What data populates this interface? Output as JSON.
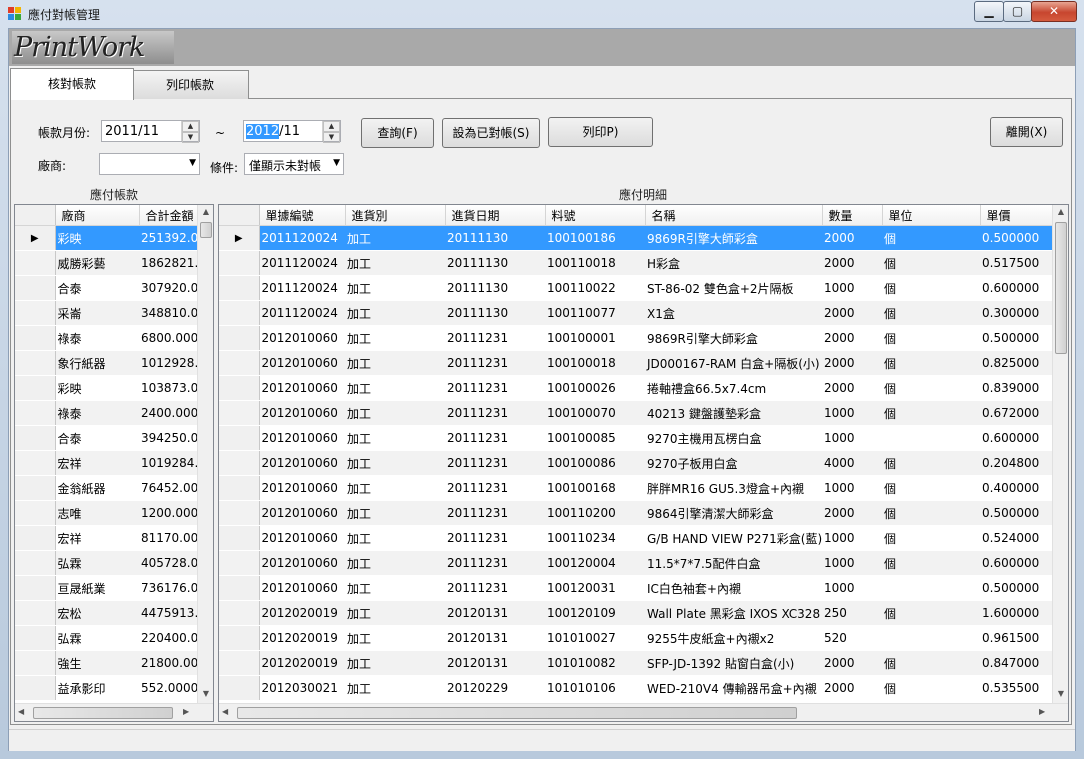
{
  "window": {
    "title": "應付對帳管理"
  },
  "logo": "PrintWork",
  "tabs": [
    {
      "label": "核對帳款"
    },
    {
      "label": "列印帳款"
    }
  ],
  "filters": {
    "period_label": "帳款月份:",
    "from_value": "2011/11",
    "tilde": "~",
    "to_year": "2012",
    "to_rest": "/11",
    "vendor_label": "廠商:",
    "vendor_value": "",
    "condition_label": "條件:",
    "condition_value": "僅顯示未對帳"
  },
  "buttons": {
    "query": "查詢(F)",
    "mark_reconciled": "設為已對帳(S)",
    "print": "列印P)",
    "leave": "離開(X)"
  },
  "left_panel": {
    "title": "應付帳款",
    "columns": [
      "廠商",
      "合計金額"
    ],
    "rows": [
      [
        "彩映",
        "251392.000"
      ],
      [
        "威勝彩藝",
        "1862821.000"
      ],
      [
        "合泰",
        "307920.000"
      ],
      [
        "采崙",
        "348810.000"
      ],
      [
        "祿泰",
        "6800.0000"
      ],
      [
        "象行紙器",
        "1012928.000"
      ],
      [
        "彩映",
        "103873.000"
      ],
      [
        "祿泰",
        "2400.0000"
      ],
      [
        "合泰",
        "394250.000"
      ],
      [
        "宏祥",
        "1019284.000"
      ],
      [
        "金翁紙器",
        "76452.0000"
      ],
      [
        "志唯",
        "1200.0000"
      ],
      [
        "宏祥",
        "81170.0000"
      ],
      [
        "弘霖",
        "405728.000"
      ],
      [
        "亘晟紙業",
        "736176.000"
      ],
      [
        "宏松",
        "4475913.000"
      ],
      [
        "弘霖",
        "220400.000"
      ],
      [
        "強生",
        "21800.0000"
      ],
      [
        "益承影印",
        "552.0000"
      ]
    ]
  },
  "right_panel": {
    "title": "應付明細",
    "columns": [
      "單據編號",
      "進貨別",
      "進貨日期",
      "料號",
      "名稱",
      "數量",
      "單位",
      "單價"
    ],
    "rows": [
      [
        "2011120024",
        "加工",
        "20111130",
        "100100186",
        "9869R引擎大師彩盒",
        "2000",
        "個",
        "0.500000"
      ],
      [
        "2011120024",
        "加工",
        "20111130",
        "100110018",
        "H彩盒",
        "2000",
        "個",
        "0.517500"
      ],
      [
        "2011120024",
        "加工",
        "20111130",
        "100110022",
        "ST-86-02 雙色盒+2片隔板",
        "1000",
        "個",
        "0.600000"
      ],
      [
        "2011120024",
        "加工",
        "20111130",
        "100110077",
        "X1盒",
        "2000",
        "個",
        "0.300000"
      ],
      [
        "2012010060",
        "加工",
        "20111231",
        "100100001",
        "9869R引擎大師彩盒",
        "2000",
        "個",
        "0.500000"
      ],
      [
        "2012010060",
        "加工",
        "20111231",
        "100100018",
        "JD000167-RAM 白盒+隔板(小)",
        "2000",
        "個",
        "0.825000"
      ],
      [
        "2012010060",
        "加工",
        "20111231",
        "100100026",
        "捲軸禮盒66.5x7.4cm",
        "2000",
        "個",
        "0.839000"
      ],
      [
        "2012010060",
        "加工",
        "20111231",
        "100100070",
        "40213 鍵盤護墊彩盒",
        "1000",
        "個",
        "0.672000"
      ],
      [
        "2012010060",
        "加工",
        "20111231",
        "100100085",
        "9270主機用瓦楞白盒",
        "1000",
        "",
        "0.600000"
      ],
      [
        "2012010060",
        "加工",
        "20111231",
        "100100086",
        "9270子板用白盒",
        "4000",
        "個",
        "0.204800"
      ],
      [
        "2012010060",
        "加工",
        "20111231",
        "100100168",
        "胖胖MR16 GU5.3燈盒+內襯",
        "1000",
        "個",
        "0.400000"
      ],
      [
        "2012010060",
        "加工",
        "20111231",
        "100110200",
        "9864引擎清潔大師彩盒",
        "2000",
        "個",
        "0.500000"
      ],
      [
        "2012010060",
        "加工",
        "20111231",
        "100110234",
        "G/B HAND VIEW P271彩盒(藍)",
        "1000",
        "個",
        "0.524000"
      ],
      [
        "2012010060",
        "加工",
        "20111231",
        "100120004",
        "11.5*7*7.5配件白盒",
        "1000",
        "個",
        "0.600000"
      ],
      [
        "2012010060",
        "加工",
        "20111231",
        "100120031",
        "IC白色袖套+內襯",
        "1000",
        "",
        "0.500000"
      ],
      [
        "2012020019",
        "加工",
        "20120131",
        "100120109",
        "Wall Plate 黑彩盒 IXOS XC328",
        "250",
        "個",
        "1.600000"
      ],
      [
        "2012020019",
        "加工",
        "20120131",
        "101010027",
        "9255牛皮紙盒+內襯x2",
        "520",
        "",
        "0.961500"
      ],
      [
        "2012020019",
        "加工",
        "20120131",
        "101010082",
        "SFP-JD-1392 貼窗白盒(小)",
        "2000",
        "個",
        "0.847000"
      ],
      [
        "2012030021",
        "加工",
        "20120229",
        "101010106",
        "WED-210V4 傳輸器吊盒+內襯",
        "2000",
        "個",
        "0.535500"
      ]
    ]
  }
}
